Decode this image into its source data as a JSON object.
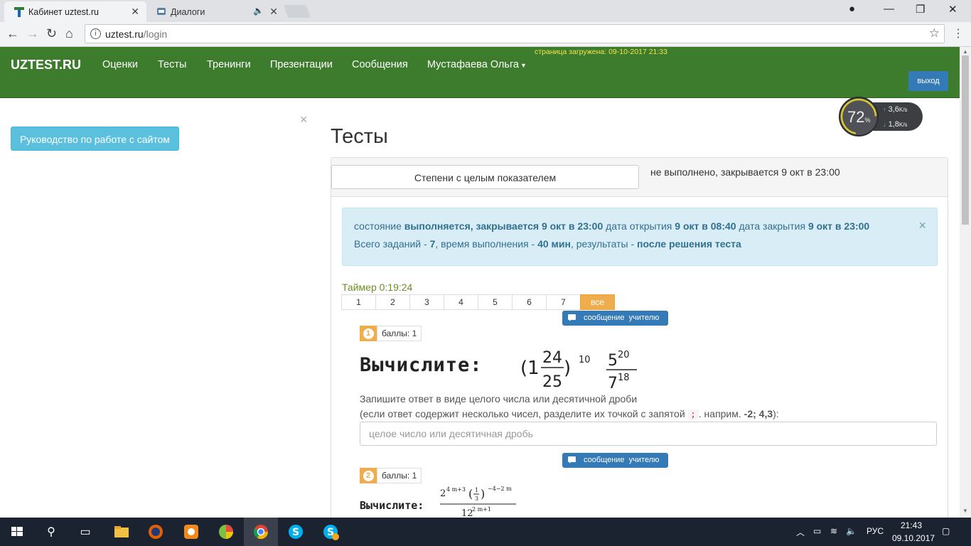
{
  "browser": {
    "tabs": [
      {
        "title": "Кабинет uztest.ru",
        "active": true
      },
      {
        "title": "Диалоги",
        "active": false
      }
    ],
    "url_host": "uztest.ru",
    "url_path": "/login"
  },
  "site": {
    "brand": "UZTEST.RU",
    "nav": [
      "Оценки",
      "Тесты",
      "Тренинги",
      "Презентации",
      "Сообщения",
      "Мустафаева Ольга"
    ],
    "loaded_text": "страница загружена: 09-10-2017 21:33",
    "exit_label": "выход"
  },
  "sidebar": {
    "guide_button": "Руководство по работе с сайтом",
    "close_symbol": "×"
  },
  "main": {
    "title": "Тесты",
    "test_name": "Степени с целым показателем",
    "test_status": "не выполнено, закрывается 9 окт в 23:00",
    "alert": {
      "l1_a": "состояние ",
      "l1_b": "выполняется, закрывается 9 окт в 23:00",
      "l1_c": " дата открытия ",
      "l1_d": "9 окт в 08:40",
      "l1_e": " дата закрытия ",
      "l1_f": "9 окт в 23:00",
      "l2_a": "Всего заданий - ",
      "l2_b": "7",
      "l2_c": ", время выполнения - ",
      "l2_d": "40 мин",
      "l2_e": ", результаты - ",
      "l2_f": "после решения теста"
    },
    "timer": "Таймер 0:19:24",
    "pages": [
      "1",
      "2",
      "3",
      "4",
      "5",
      "6",
      "7",
      "все"
    ],
    "message_teacher": "сообщение  учителю",
    "q1": {
      "num": "1",
      "points": "баллы: 1",
      "verb": "Вычислите:",
      "instr1": "Запишите ответ в виде целого числа или десятичной дроби",
      "instr2a": "(если ответ содержит несколько чисел, разделите их точкой с запятой ",
      "instr2_code": ";",
      "instr2b": ". наприм. ",
      "instr2_ex": "-2; 4,3",
      "instr2c": "):",
      "placeholder": "целое число или десятичная дробь"
    },
    "q2": {
      "num": "2",
      "points": "баллы: 1",
      "verb": "Вычислите:"
    }
  },
  "speed_widget": {
    "percent": "72",
    "pct_sign": "%",
    "up": "3,6",
    "down": "1,8",
    "unit": "K/s"
  },
  "taskbar": {
    "lang": "РУС",
    "time": "21:43",
    "date": "09.10.2017"
  }
}
